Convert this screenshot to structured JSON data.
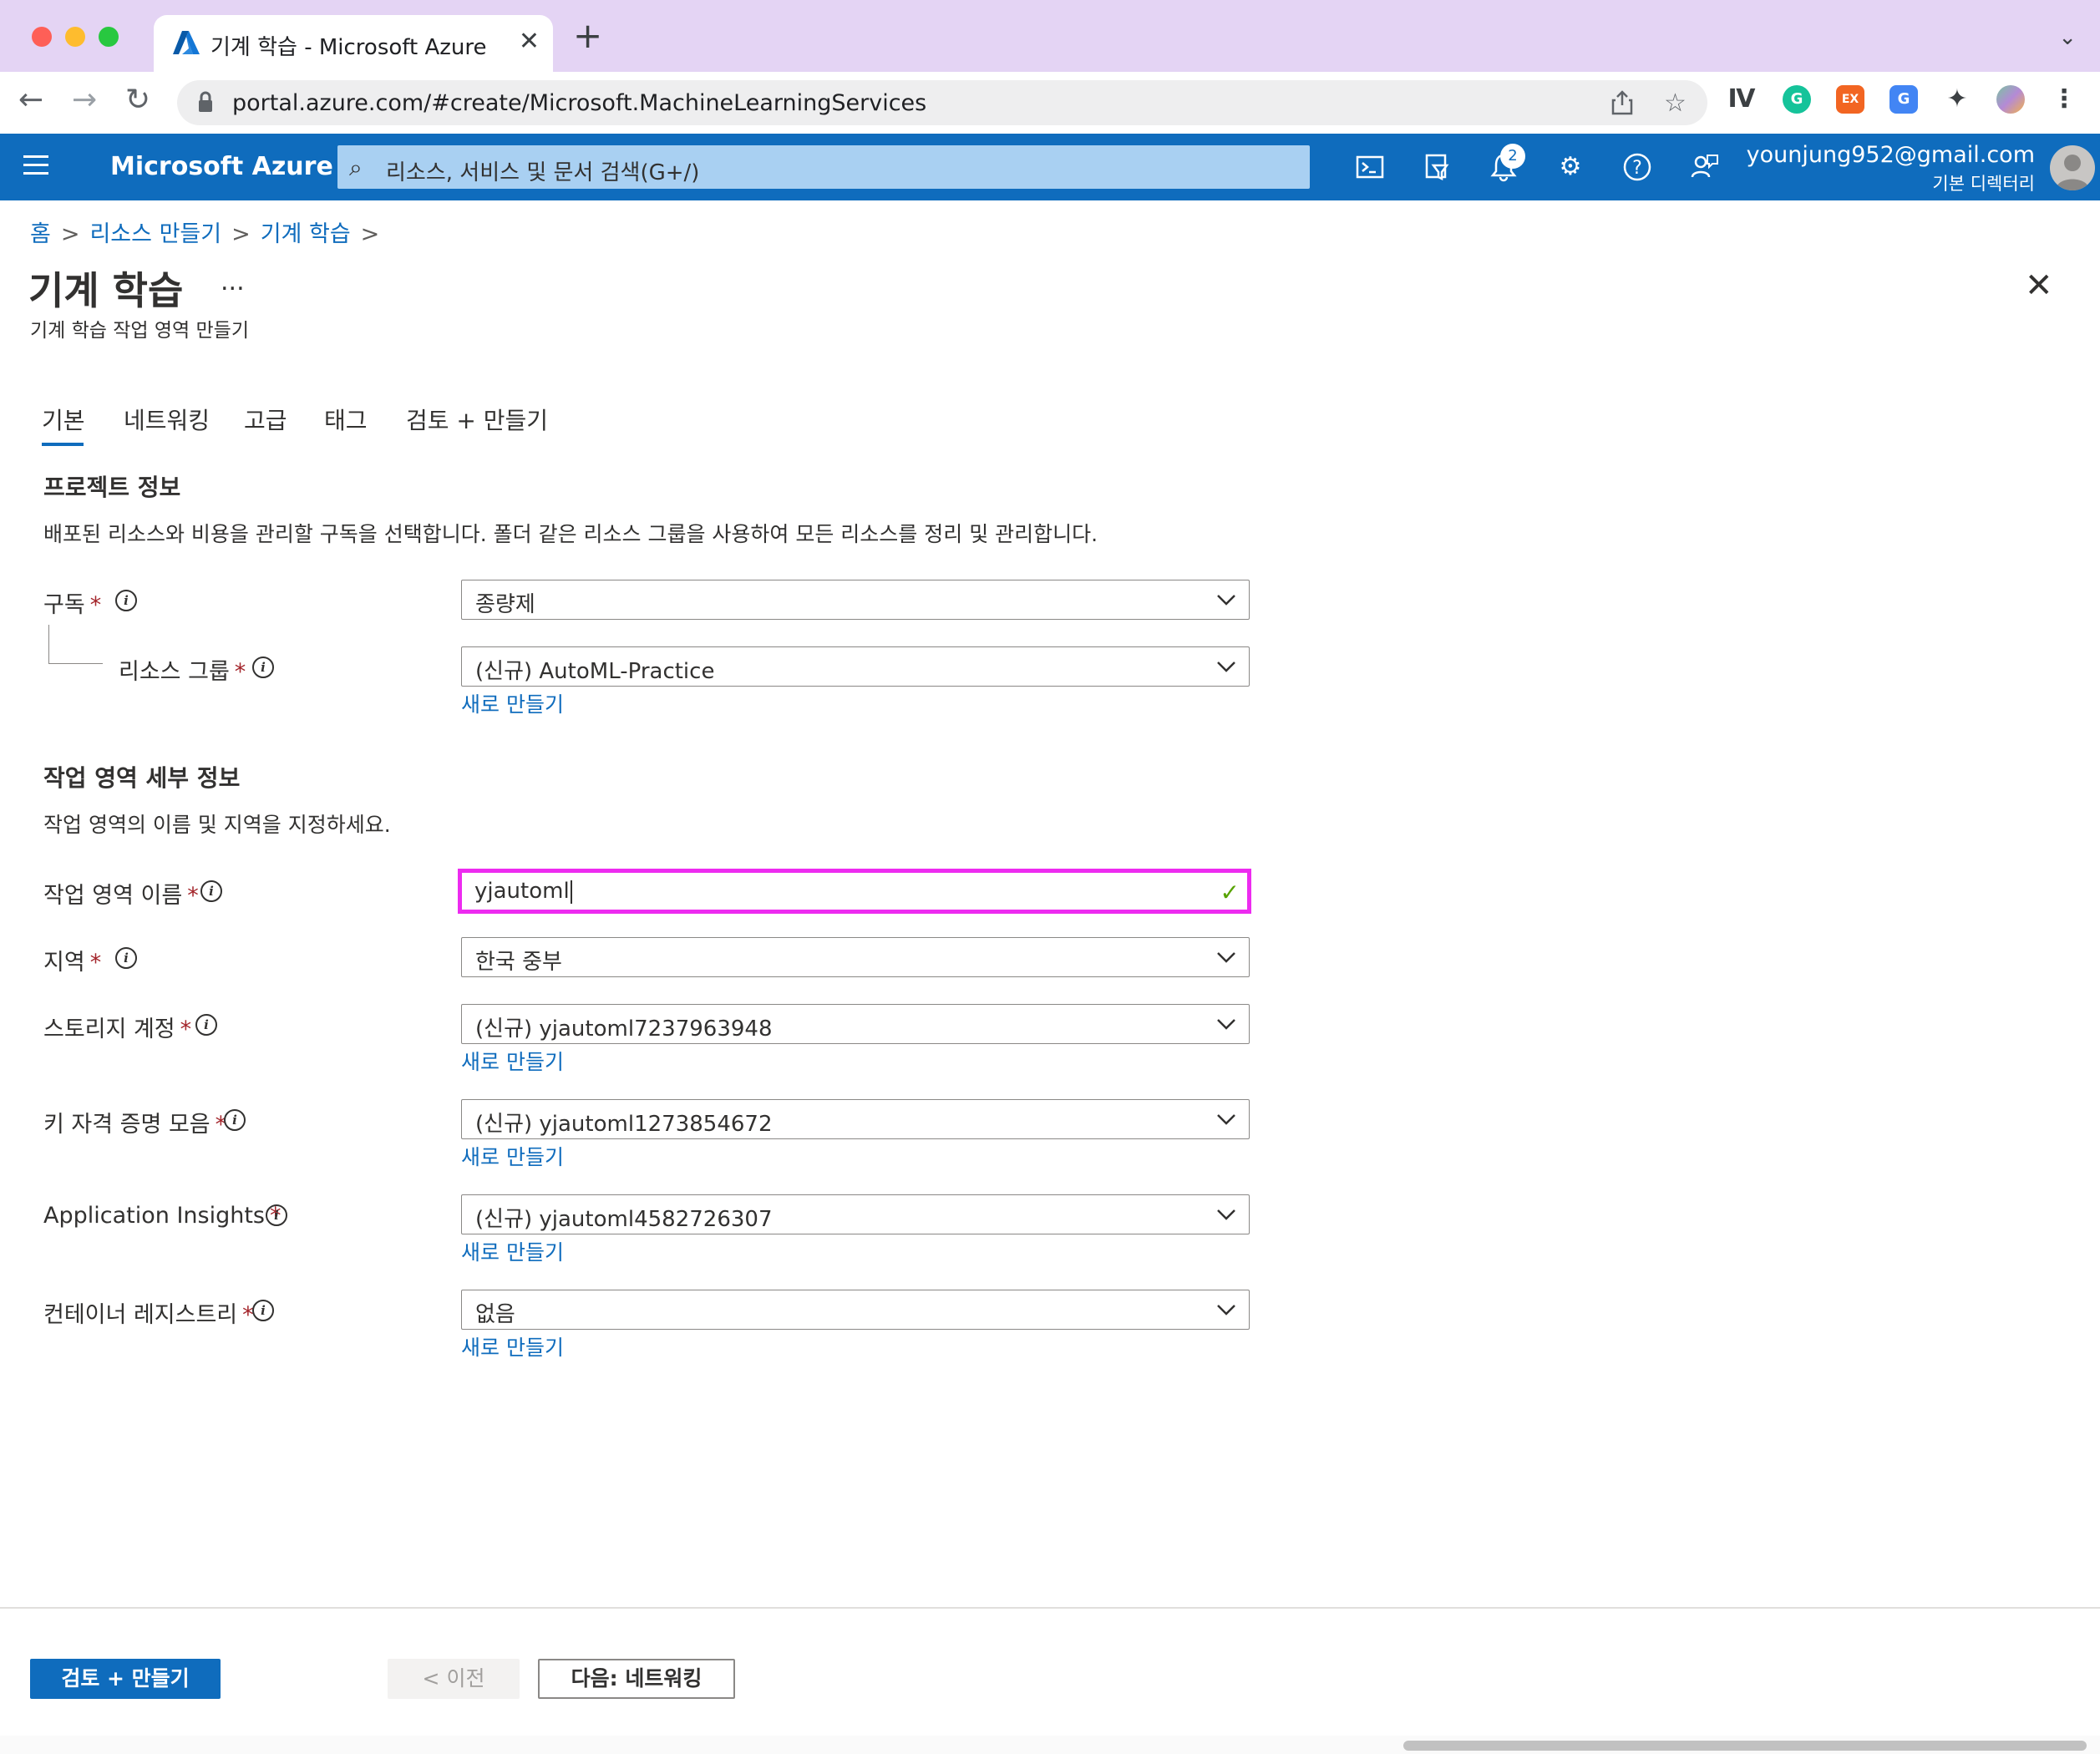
{
  "browser": {
    "tab_title": "기계 학습 - Microsoft Azure",
    "url": "portal.azure.com/#create/Microsoft.MachineLearningServices",
    "new_tab": "+",
    "close_tab": "✕"
  },
  "azure": {
    "brand": "Microsoft Azure",
    "search_placeholder": "리소스, 서비스 및 문서 검색(G+/)",
    "notification_count": "2",
    "user_email": "younjung952@gmail.com",
    "user_directory": "기본 디렉터리",
    "accent_color": "#0f6cbd"
  },
  "breadcrumb": {
    "home": "홈",
    "create_resource": "리소스 만들기",
    "machine_learning": "기계 학습",
    "separator": ">"
  },
  "page": {
    "title": "기계 학습",
    "ellipsis": "...",
    "subtitle": "기계 학습 작업 영역 만들기"
  },
  "tabs": [
    {
      "label": "기본"
    },
    {
      "label": "네트워킹"
    },
    {
      "label": "고급"
    },
    {
      "label": "태그"
    },
    {
      "label": "검토 + 만들기"
    }
  ],
  "project": {
    "heading": "프로젝트 정보",
    "description": "배포된 리소스와 비용을 관리할 구독을 선택합니다. 폴더 같은 리소스 그룹을 사용하여 모든 리소스를 정리 및 관리합니다.",
    "subscription_label": "구독",
    "subscription_value": "종량제",
    "resource_group_label": "리소스 그룹",
    "resource_group_value": "(신규) AutoML-Practice"
  },
  "workspace": {
    "heading": "작업 영역 세부 정보",
    "description": "작업 영역의 이름 및 지역을 지정하세요.",
    "name_label": "작업 영역 이름",
    "name_value": "yjautoml",
    "region_label": "지역",
    "region_value": "한국 중부",
    "storage_label": "스토리지 계정",
    "storage_value": "(신규) yjautoml7237963948",
    "keyvault_label": "키 자격 증명 모음",
    "keyvault_value": "(신규) yjautoml1273854672",
    "appinsights_label": "Application Insights",
    "appinsights_value": "(신규) yjautoml4582726307",
    "registry_label": "컨테이너 레지스트리",
    "registry_value": "없음"
  },
  "common": {
    "required_mark": "*",
    "info_glyph": "i",
    "create_new": "새로 만들기"
  },
  "footer": {
    "review_create": "검토 + 만들기",
    "previous": "< 이전",
    "next": "다음: 네트워킹"
  }
}
